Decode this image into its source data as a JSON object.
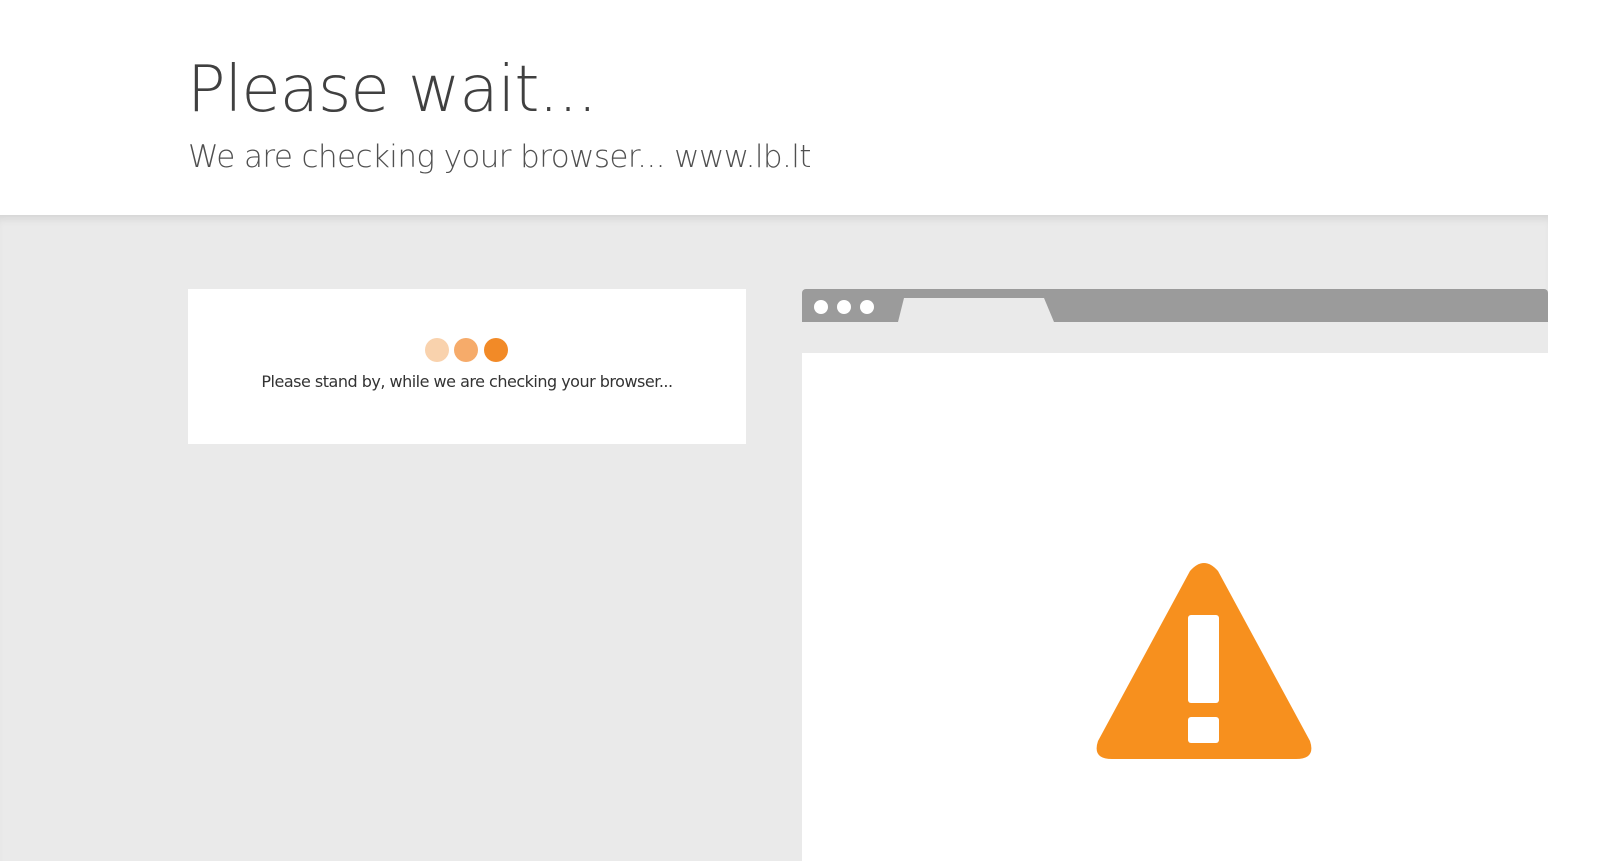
{
  "header": {
    "title": "Please wait...",
    "subtitle": "We are checking your browser... www.lb.lt"
  },
  "status_card": {
    "message": "Please stand by, while we are checking your browser...",
    "loader_dots": [
      "#f9d2ad",
      "#f6ab6a",
      "#f28a27"
    ]
  },
  "browser_illustration": {
    "chrome_color": "#9b9b9b",
    "icon": "warning-icon",
    "icon_color": "#f7901e"
  },
  "colors": {
    "page_background": "#ffffff",
    "content_background": "#eaeaea",
    "accent": "#f7901e"
  }
}
